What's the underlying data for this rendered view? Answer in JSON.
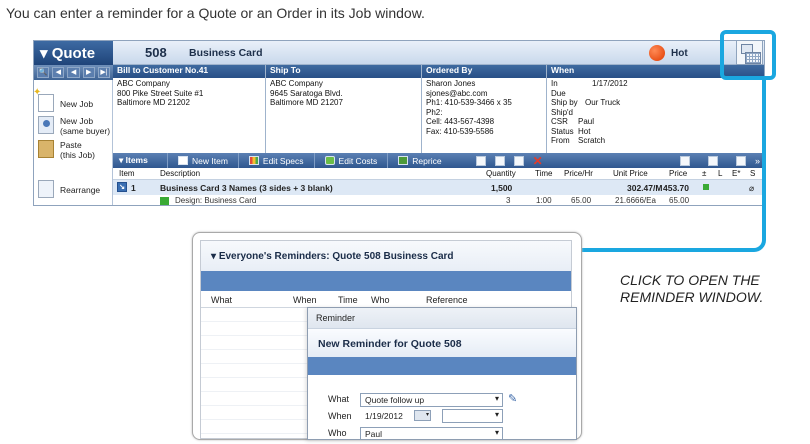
{
  "caption": "You can enter a reminder for a Quote or an Order in its Job window.",
  "quote_window": {
    "title": "Quote",
    "number": "508",
    "job_name": "Business Card",
    "status": "Hot",
    "nav_buttons": [
      "🔍",
      "◀",
      "◀",
      "▶",
      "▶|"
    ],
    "sidebar": [
      {
        "label": "New Job"
      },
      {
        "label": "New Job\n(same buyer)"
      },
      {
        "label": "Paste\n(this Job)"
      },
      {
        "label": "Rearrange"
      }
    ],
    "bill_to": {
      "header": "Bill to Customer No.41",
      "lines": [
        "ABC Company",
        "800 Pike Street Suite #1",
        "Baltimore MD 21202"
      ]
    },
    "ship_to": {
      "header": "Ship To",
      "lines": [
        "ABC Company",
        "9645 Saratoga Blvd.",
        "Baltimore MD 21207"
      ]
    },
    "ordered_by": {
      "header": "Ordered By",
      "lines": [
        "Sharon Jones",
        "sjones@abc.com",
        "Ph1: 410-539-3466 x 35",
        "Ph2:",
        "Cell: 443-567-4398",
        "Fax: 410-539-5586"
      ]
    },
    "when": {
      "header": "When",
      "rows": [
        {
          "k": "In",
          "v": "1/17/2012"
        },
        {
          "k": "Due",
          "v": ""
        },
        {
          "k": "Ship by",
          "v": "Our Truck"
        },
        {
          "k": "Ship'd",
          "v": ""
        },
        {
          "k": "CSR",
          "v": "Paul"
        },
        {
          "k": "Status",
          "v": "Hot"
        },
        {
          "k": "From",
          "v": "Scratch"
        }
      ]
    },
    "items_bar": {
      "title": "Items",
      "buttons": [
        "New Item",
        "Edit Specs",
        "Edit Costs",
        "Reprice"
      ]
    },
    "columns": {
      "item": "Item",
      "description": "Description",
      "quantity": "Quantity",
      "time": "Time",
      "price_hr": "Price/Hr",
      "unit_price": "Unit Price",
      "price": "Price",
      "pm": "±",
      "l": "L",
      "e": "E*",
      "s": "S"
    },
    "rows": [
      {
        "item": "1",
        "description": "Business Card  3 Names  (3 sides + 3 blank)",
        "quantity": "1,500",
        "time": "",
        "price_hr": "",
        "unit_price": "302.47/M",
        "price": "453.70"
      },
      {
        "item": "",
        "description": "Design: Business Card",
        "quantity": "3",
        "time": "1:00",
        "price_hr": "65.00",
        "unit_price": "21.6666/Ea",
        "price": "65.00"
      }
    ]
  },
  "callout": "CLICK TO OPEN THE REMINDER WINDOW.",
  "reminders_window": {
    "title": "Everyone's Reminders: Quote 508 Business Card",
    "columns": [
      "What",
      "When",
      "Time",
      "Who",
      "Reference"
    ]
  },
  "reminder_dialog": {
    "titlebar": "Reminder",
    "heading": "New Reminder for Quote 508",
    "what_label": "What",
    "what_value": "Quote follow up",
    "when_label": "When",
    "when_value": "1/19/2012",
    "who_label": "Who",
    "who_value": "Paul"
  },
  "colors": {
    "accent": "#1aa7e0",
    "header_blue": "#2f578f",
    "hot": "#e03a00"
  }
}
